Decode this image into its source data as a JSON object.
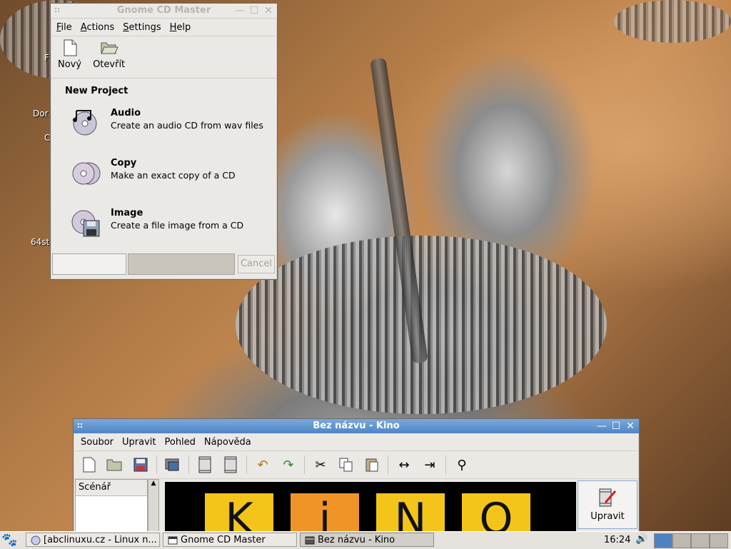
{
  "desktop": {
    "icon_labels": [
      "Dor",
      "64st"
    ],
    "partial_letters": [
      "F",
      "C"
    ]
  },
  "cdmaster": {
    "title": "Gnome CD Master",
    "menu": [
      "File",
      "Actions",
      "Settings",
      "Help"
    ],
    "menu_mnemonic": [
      "F",
      "A",
      "S",
      "H"
    ],
    "toolbar": {
      "new_label": "Nový",
      "open_label": "Otevřít"
    },
    "section_title": "New Project",
    "projects": [
      {
        "name": "Audio",
        "desc": "Create an audio CD from wav files"
      },
      {
        "name": "Copy",
        "desc": "Make an exact copy of a CD"
      },
      {
        "name": "Image",
        "desc": "Create a file image from a CD"
      }
    ],
    "cancel_label": "Cancel"
  },
  "kino": {
    "title": "Bez názvu - Kino",
    "menu": [
      "Soubor",
      "Upravit",
      "Pohled",
      "Nápověda"
    ],
    "storyboard_header": "Scénář",
    "edit_label": "Upravit",
    "logo_letters": [
      "K",
      "i",
      "N",
      "O"
    ]
  },
  "taskbar": {
    "tasks": [
      "[abclinuxu.cz - Linux n...",
      "Gnome CD Master",
      "Bez názvu - Kino"
    ],
    "clock": "16:24"
  },
  "colors": {
    "active_title": "#4f85c6",
    "kino_yellow": "#f3c51a",
    "kino_orange": "#f09428"
  }
}
